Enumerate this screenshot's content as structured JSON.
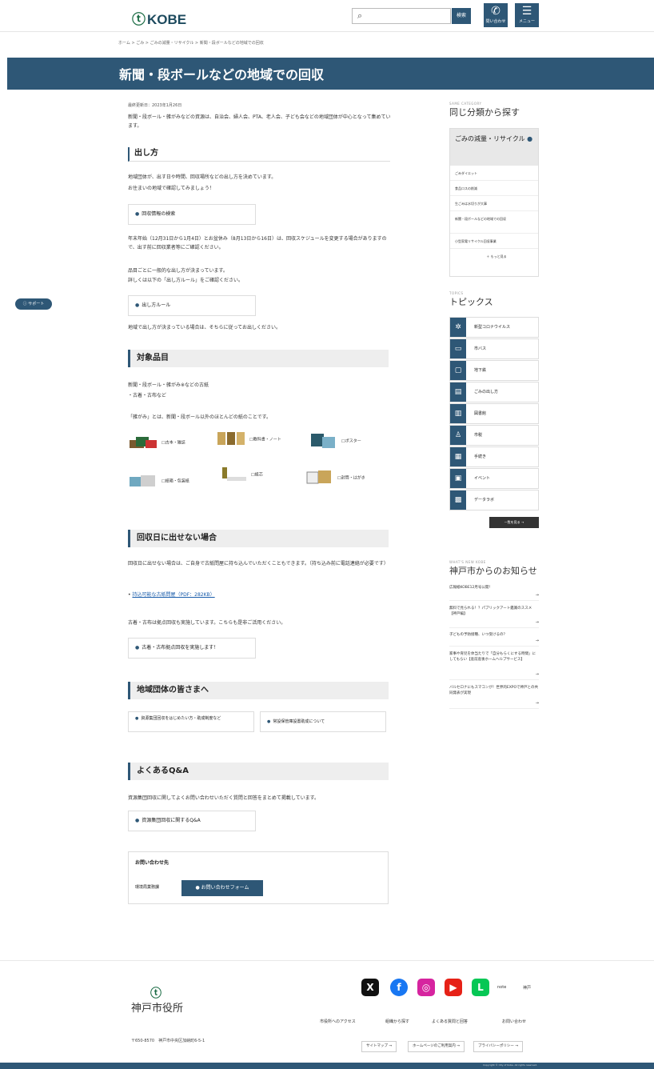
{
  "header": {
    "logo": "KOBE",
    "logo_mark": "ⓣ",
    "search_placeholder": "",
    "search_btn": "検索",
    "contact_label": "問い合わせ",
    "menu_label": "メニュー"
  },
  "breadcrumb": "ホーム > ごみ > ごみの減量・リサイクル > 新聞・段ボールなどの地域での回収",
  "page_title": "新聞・段ボールなどの地域での回収",
  "updated": "最終更新日：2023年1月26日",
  "intro": "新聞・段ボール・雑がみなどの資源は、自治会、婦人会、PTA、老人会、子ども会などの地域団体が中心となって集めています。",
  "sec1": {
    "title": "出し方",
    "p1": "地域団体が、出す日や時間、回収場所などの出し方を決めています。",
    "p2": "お住まいの地域で確認してみましょう！",
    "link1": "回収情報の検索",
    "p3": "年末年始（12月31日から1月4日）とお盆休み（8月13日から16日）は、回収スケジュールを変更する場合がありますので、出す前に回収業者等にご確認ください。",
    "p4": "品目ごとに一般的な出し方が決まっています。",
    "p5": "詳しくは以下の「出し方ルール」をご確認ください。",
    "link2": "出し方ルール",
    "p6": "地域で出し方が決まっている場合は、そちらに従ってお出しください。"
  },
  "sec2": {
    "title": "対象品目",
    "p1": "新聞・段ボール・雑がみ※などの古紙",
    "p2": "・古着・古布など",
    "p3": "「雑がみ」とは、新聞・段ボール以外のほとんどの紙のことです。",
    "items": [
      "□古本・雑誌",
      "□教科書・ノート",
      "□ポスター",
      "□紙箱・包装紙",
      "□紙芯",
      "□封筒・はがき"
    ]
  },
  "sec3": {
    "title": "回収日に出せない場合",
    "p1": "回収日に出せない場合は、ご自身で古紙問屋に持ち込んでいただくこともできます。（持ち込み前に電話連絡が必要です）",
    "link": "持込可能な古紙問屋（PDF：282KB）",
    "p2": "古着・古布は拠点回収も実施しています。こちらも是非ご活用ください。",
    "box": "古着・古布拠点回収を実施します！"
  },
  "sec4": {
    "title": "地域団体の皆さまへ",
    "box1": "資源集団回収をはじめたい方・助成制度など",
    "box2": "常設保管庫設置助成について"
  },
  "sec5": {
    "title": "よくあるQ&A",
    "p1": "資源集団回収に関してよくお問い合わせいただく質問と回答をまとめて掲載しています。",
    "box": "資源集団回収に関するQ&A"
  },
  "contact": {
    "title": "お問い合わせ先",
    "dept": "環境局業務課",
    "form": "お問い合わせフォーム"
  },
  "support": "サポート",
  "side": {
    "cat_en": "SAME CATEGORY",
    "cat_jp": "同じ分類から探す",
    "cat_head": "ごみの減量・リサイクル",
    "cat_items": [
      "ごみダイエット",
      "食品ロスの削減",
      "生ごみは水切りが大事",
      "新聞・段ボールなどの地域での回収",
      "小型家電リサイクル回収事業"
    ],
    "cat_more": "＋ もっと見る",
    "topics_en": "TOPICS",
    "topics_jp": "トピックス",
    "topics": [
      "新型コロナウイルス",
      "市バス",
      "地下鉄",
      "ごみの出し方",
      "図書館",
      "市税",
      "手続き",
      "イベント",
      "データラボ"
    ],
    "topics_more": "一覧を見る",
    "news_en": "WHAT'S NEW KOBE",
    "news_jp": "神戸市からのお知らせ",
    "news": [
      "広報紙KOBE12月号公開！",
      "無料で見られる！？パブリックアート鑑賞のススメ【神戸編】",
      "子どもの予防接種、いつ受けるの？",
      "家事や育児を体当たりで「自分もらくにする時間」にしてもらい【産前産後ホームヘルプサービス】",
      "バルセロナにもスマコンが！世界的EXPOで神戸との共同発表が実現"
    ]
  },
  "footer": {
    "logo": "ⓣ",
    "name": "神戸市役所",
    "address": "〒650-8570　神戸市中央区加納町6-5-1",
    "links": [
      "市役所へのアクセス",
      "組織から探す",
      "よくある質問と回答",
      "お問い合わせ"
    ],
    "buttons": [
      "サイトマップ",
      "ホームページのご利用案内",
      "プライバシーポリシー"
    ],
    "sns": [
      "X",
      "f",
      "◎",
      "▶",
      "L"
    ],
    "note": "note",
    "kobe": "神戸",
    "copyright": "Copyright © City of Kobe. All rights reserved."
  },
  "colors": {
    "brand": "#2e5776",
    "green": "#1b6c45"
  }
}
